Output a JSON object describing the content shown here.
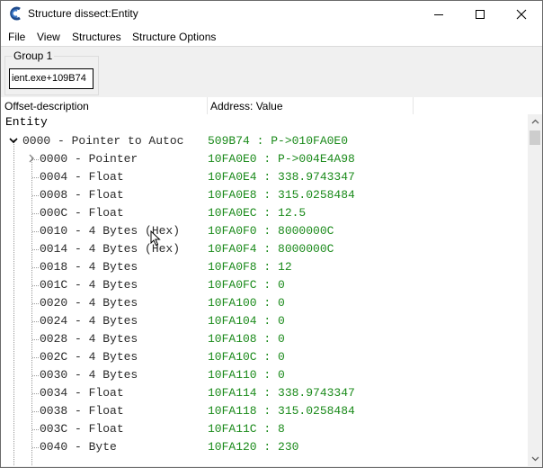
{
  "window": {
    "title": "Structure dissect:Entity"
  },
  "menu": [
    "File",
    "View",
    "Structures",
    "Structure Options"
  ],
  "group": {
    "label": "Group 1",
    "address": "ient.exe+109B74"
  },
  "columns": {
    "offset": "Offset-description",
    "address": "Address: Value"
  },
  "tree": {
    "root": "Entity",
    "pointer_row": {
      "desc": "0000 - Pointer to Autoc",
      "value": "509B74 : P->010FA0E0"
    },
    "rows": [
      {
        "desc": "0000 - Pointer",
        "value": "10FA0E0 : P->004E4A98",
        "expandable": true
      },
      {
        "desc": "0004 - Float",
        "value": "10FA0E4 : 338.9743347"
      },
      {
        "desc": "0008 - Float",
        "value": "10FA0E8 : 315.0258484"
      },
      {
        "desc": "000C - Float",
        "value": "10FA0EC : 12.5"
      },
      {
        "desc": "0010 - 4 Bytes (Hex)",
        "value": "10FA0F0 : 8000000C"
      },
      {
        "desc": "0014 - 4 Bytes (Hex)",
        "value": "10FA0F4 : 8000000C"
      },
      {
        "desc": "0018 - 4 Bytes",
        "value": "10FA0F8 : 12"
      },
      {
        "desc": "001C - 4 Bytes",
        "value": "10FA0FC : 0"
      },
      {
        "desc": "0020 - 4 Bytes",
        "value": "10FA100 : 0"
      },
      {
        "desc": "0024 - 4 Bytes",
        "value": "10FA104 : 0"
      },
      {
        "desc": "0028 - 4 Bytes",
        "value": "10FA108 : 0"
      },
      {
        "desc": "002C - 4 Bytes",
        "value": "10FA10C : 0"
      },
      {
        "desc": "0030 - 4 Bytes",
        "value": "10FA110 : 0"
      },
      {
        "desc": "0034 - Float",
        "value": "10FA114 : 338.9743347"
      },
      {
        "desc": "0038 - Float",
        "value": "10FA118 : 315.0258484"
      },
      {
        "desc": "003C - Float",
        "value": "10FA11C : 8"
      },
      {
        "desc": "0040 - Byte",
        "value": "10FA120 : 230"
      }
    ]
  },
  "icons": {
    "app": "cheat-engine-icon",
    "minimize": "minimize-icon",
    "maximize": "maximize-icon",
    "close": "close-icon",
    "cursor": "mouse-cursor-icon"
  },
  "colors": {
    "value_text": "#1a8a1a",
    "tree_lines": "#999999"
  }
}
